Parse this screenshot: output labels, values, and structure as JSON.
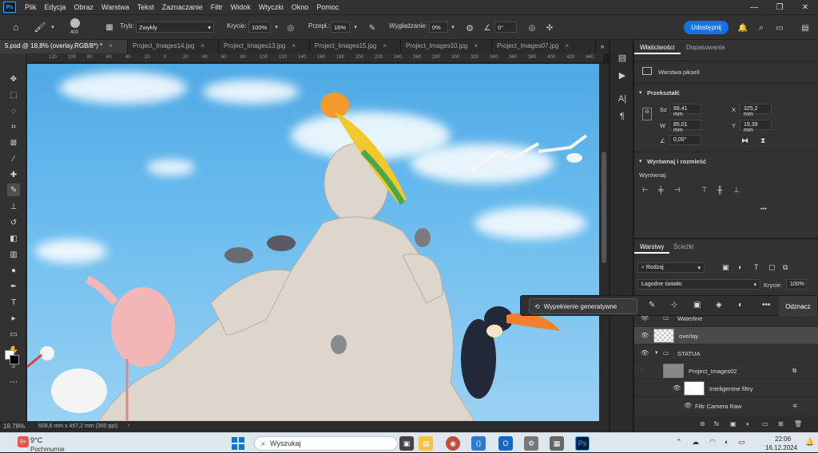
{
  "app": {
    "logo": "Ps",
    "menu": [
      "Plik",
      "Edycja",
      "Obraz",
      "Warstwa",
      "Tekst",
      "Zaznaczanie",
      "Filtr",
      "Widok",
      "Wtyczki",
      "Okno",
      "Pomoc"
    ]
  },
  "options": {
    "brush_size": "400",
    "mode_label": "Tryb:",
    "mode_value": "Zwykły",
    "opacity_label": "Krycie:",
    "opacity_value": "100%",
    "flow_label": "Przepł.:",
    "flow_value": "16%",
    "smoothing_label": "Wygładzanie:",
    "smoothing_value": "0%",
    "angle_value": "0°",
    "share_label": "Udostępnij"
  },
  "tabs": [
    {
      "label": "5.psd @ 18,8% (overlay,RGB/8*) *",
      "active": true
    },
    {
      "label": "Project_Images14.jpg",
      "active": false
    },
    {
      "label": "Project_Images13.jpg",
      "active": false
    },
    {
      "label": "Project_Images15.jpg",
      "active": false
    },
    {
      "label": "Project_Images10.jpg",
      "active": false
    },
    {
      "label": "Project_Images07.jpg",
      "active": false
    }
  ],
  "ruler": [
    "120",
    "100",
    "80",
    "60",
    "40",
    "20",
    "0",
    "20",
    "40",
    "60",
    "80",
    "100",
    "120",
    "140",
    "160",
    "180",
    "200",
    "220",
    "240",
    "260",
    "280",
    "300",
    "320",
    "340",
    "360",
    "380",
    "400",
    "420",
    "440"
  ],
  "status": {
    "zoom": "18.78%",
    "doc_info": "609,6 mm x 457,2 mm (300 ppi)"
  },
  "properties": {
    "tab_active": "Właściwości",
    "tab_other": "Dopasowania",
    "layer_type": "Warstwa pikseli",
    "transform_title": "Przekształć",
    "w_label": "Sz",
    "w_value": "68,41 mm",
    "h_label": "W",
    "h_value": "85,01 mm",
    "x_label": "X",
    "x_value": "325,2 mm",
    "y_label": "Y",
    "y_value": "19,39 mm",
    "angle_value": "0,00°",
    "align_title": "Wyrównaj i rozmieść",
    "align_label": "Wyrównaj:",
    "more": "•••"
  },
  "layers": {
    "tab_active": "Warstwy",
    "tab_other": "Ścieżki",
    "filter_label": "Rodzaj",
    "blend_mode": "Łagodne światło",
    "opacity_label": "Krycie:",
    "opacity_value": "100%",
    "rows": [
      {
        "name": "Waterline",
        "kind": "group"
      },
      {
        "name": "overlay",
        "kind": "layer"
      },
      {
        "name": "STATUA",
        "kind": "group"
      },
      {
        "name": "Project_Images02",
        "kind": "smart"
      },
      {
        "name": "Inteligentne filtry",
        "kind": "filter"
      },
      {
        "name": "Filtr Camera Raw",
        "kind": "filter-item"
      }
    ]
  },
  "context_bar": {
    "generative_fill": "Wypełnienie generatywne",
    "deselect": "Odznacz"
  },
  "taskbar": {
    "weather_temp": "9°C",
    "weather_desc": "Pochmurnie",
    "weather_badge": "9+",
    "search_placeholder": "Wyszukaj",
    "time": "22:06",
    "date": "16.12.2024"
  }
}
